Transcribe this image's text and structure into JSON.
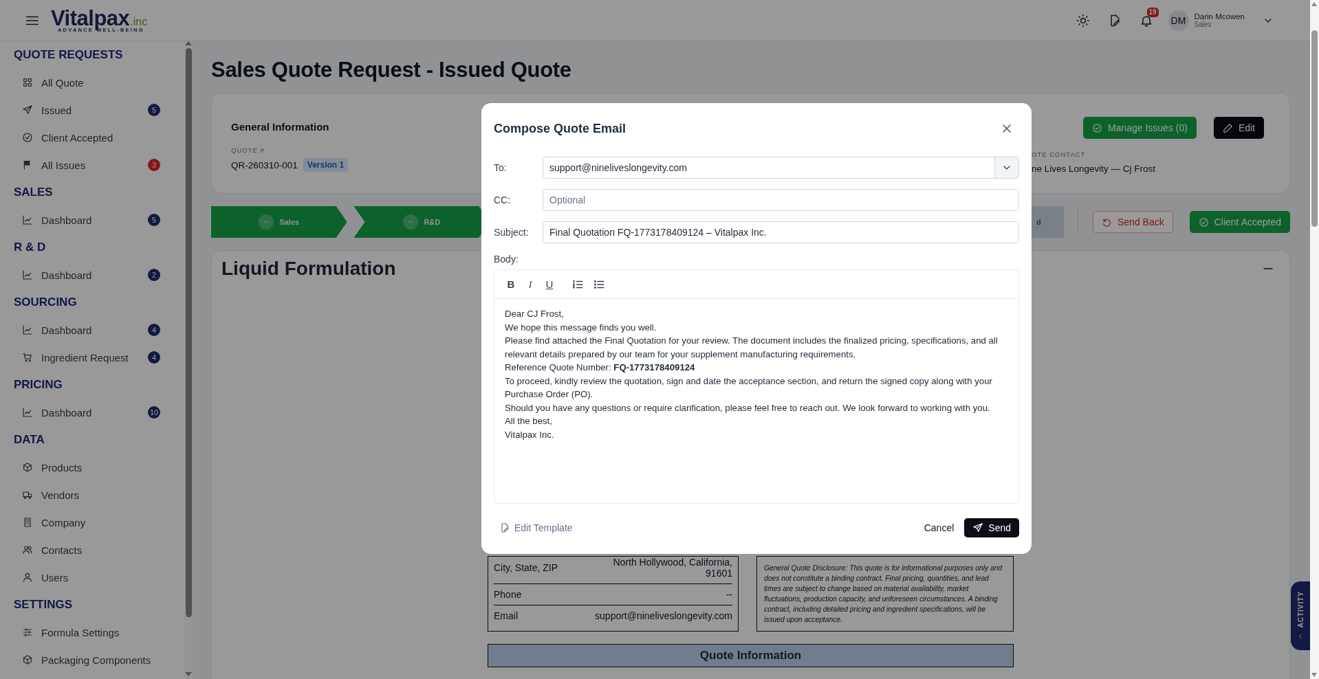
{
  "header": {
    "logo": {
      "name": "Vitalpax",
      "suffix": ".inc",
      "tagline": "ADVANCE WELL-BEING"
    },
    "notification_count": "19",
    "user": {
      "initials": "DM",
      "name": "Darin Mcowen",
      "role": "Sales"
    }
  },
  "sidebar": {
    "sections": [
      {
        "title": "QUOTE REQUESTS",
        "items": [
          {
            "label": "All Quote"
          },
          {
            "label": "Issued",
            "badge": {
              "text": "5",
              "color": "#121a42"
            }
          },
          {
            "label": "Client Accepted"
          },
          {
            "label": "All Issues",
            "badge": {
              "text": "3",
              "color": "#84171a"
            }
          }
        ]
      },
      {
        "title": "SALES",
        "items": [
          {
            "label": "Dashboard",
            "badge": {
              "text": "5",
              "color": "#121a42"
            }
          }
        ]
      },
      {
        "title": "R & D",
        "items": [
          {
            "label": "Dashboard",
            "badge": {
              "text": "2",
              "color": "#121a42"
            }
          }
        ]
      },
      {
        "title": "SOURCING",
        "items": [
          {
            "label": "Dashboard",
            "badge": {
              "text": "4",
              "color": "#121a42"
            }
          },
          {
            "label": "Ingredient Request",
            "badge": {
              "text": "4",
              "color": "#121a42"
            }
          }
        ]
      },
      {
        "title": "PRICING",
        "items": [
          {
            "label": "Dashboard",
            "badge": {
              "text": "10",
              "color": "#121a42"
            }
          }
        ]
      },
      {
        "title": "DATA",
        "items": [
          {
            "label": "Products"
          },
          {
            "label": "Vendors"
          },
          {
            "label": "Company"
          },
          {
            "label": "Contacts"
          },
          {
            "label": "Users"
          }
        ]
      },
      {
        "title": "SETTINGS",
        "items": [
          {
            "label": "Formula Settings"
          },
          {
            "label": "Packaging Components"
          }
        ]
      }
    ]
  },
  "page": {
    "title": "Sales Quote Request - Issued Quote",
    "general_info": {
      "heading": "General Information",
      "quote_label": "QUOTE #",
      "quote_number": "QR-260310-001",
      "version": "Version 1",
      "contact_label": "OTE CONTACT",
      "contact_value": "ne Lives Longevity — Cj Frost",
      "buttons": [
        {
          "label": "Manage Issues (0)",
          "kind": "success"
        },
        {
          "label": "Edit",
          "kind": "dark"
        }
      ]
    },
    "steps": [
      {
        "label": "Sales",
        "done": true
      },
      {
        "label": "R&D",
        "done": true
      },
      {
        "label": "d",
        "done": false
      }
    ],
    "actions": [
      {
        "label": "Send Back",
        "kind": "outline-danger"
      },
      {
        "label": "Client Accepted",
        "kind": "success"
      }
    ],
    "formulation": {
      "title": "Liquid Formulation",
      "contact_rows": [
        {
          "label": "City, State, ZIP",
          "value": "North Hollywood, California, 91601"
        },
        {
          "label": "Phone",
          "value": "--"
        },
        {
          "label": "Email",
          "value": "support@nineliveslongevity.com"
        }
      ],
      "disclaimer": "General Quote Disclosure: This quote is for informational purposes only and does not constitute a binding contract. Final pricing, quantities, and lead times are subject to change based on material availability, market fluctuations, production capacity, and unforeseen circumstances. A binding contract, including detailed pricing and ingredient specifications, will be issued upon acceptance.",
      "quote_info_heading": "Quote Information"
    }
  },
  "activity_tab": {
    "label": "ACTIVITY"
  },
  "modal": {
    "title": "Compose Quote Email",
    "fields": [
      {
        "label": "To:",
        "kind": "select",
        "value": "support@nineliveslongevity.com"
      },
      {
        "label": "CC:",
        "kind": "text",
        "placeholder": "Optional"
      },
      {
        "label": "Subject:",
        "kind": "text",
        "value": "Final Quotation FQ-1773178409124 – Vitalpax Inc."
      }
    ],
    "body_label": "Body:",
    "format_buttons": [
      {
        "label": "B",
        "kind": "bold"
      },
      {
        "label": "I",
        "kind": "italic"
      },
      {
        "label": "U",
        "kind": "underline"
      }
    ],
    "body": [
      "Dear CJ Frost,",
      "We hope this message finds you well.",
      "Please find attached the Final Quotation for your review. The document includes the finalized pricing, specifications, and all relevant details prepared by our team for your supplement manufacturing requirements.",
      "Reference Quote Number: **FQ-1773178409124**",
      "To proceed, kindly review the quotation, sign and date the acceptance section, and return the signed copy along with your Purchase Order (PO).",
      "Should you have any questions or require clarification, please feel free to reach out. We look forward to working with you.",
      "All the best,",
      "Vitalpax Inc."
    ],
    "edit_template": "Edit Template",
    "cancel": "Cancel",
    "send": "Send"
  }
}
